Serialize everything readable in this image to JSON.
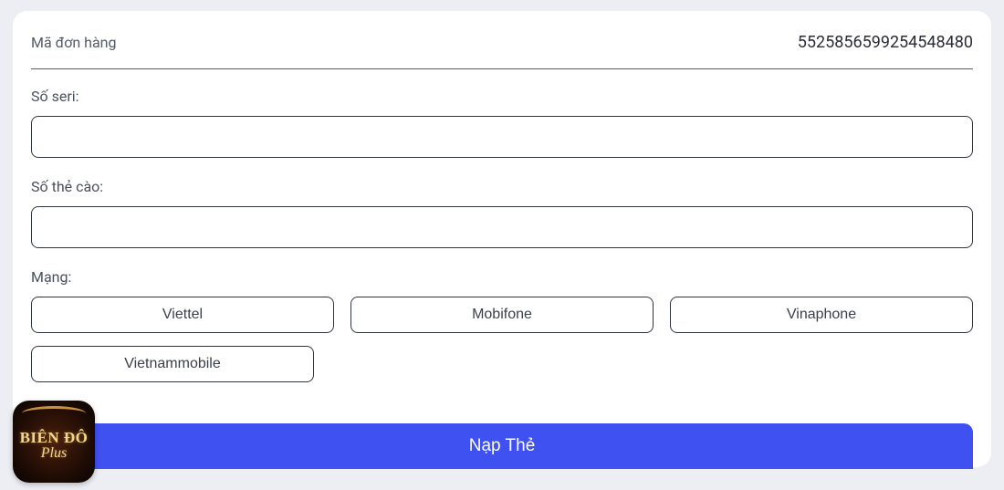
{
  "order": {
    "label": "Mã đơn hàng",
    "value": "5525856599254548480"
  },
  "fields": {
    "seri_label": "Số seri:",
    "seri_value": "",
    "card_label": "Số thẻ cào:",
    "card_value": "",
    "network_label": "Mạng:"
  },
  "networks": {
    "viettel": "Viettel",
    "mobifone": "Mobifone",
    "vinaphone": "Vinaphone",
    "vietnammobile": "Vietnammobile"
  },
  "submit_label": "Nạp Thẻ",
  "logo": {
    "line1": "BIÊN ĐÔ",
    "line2": "Plus"
  }
}
